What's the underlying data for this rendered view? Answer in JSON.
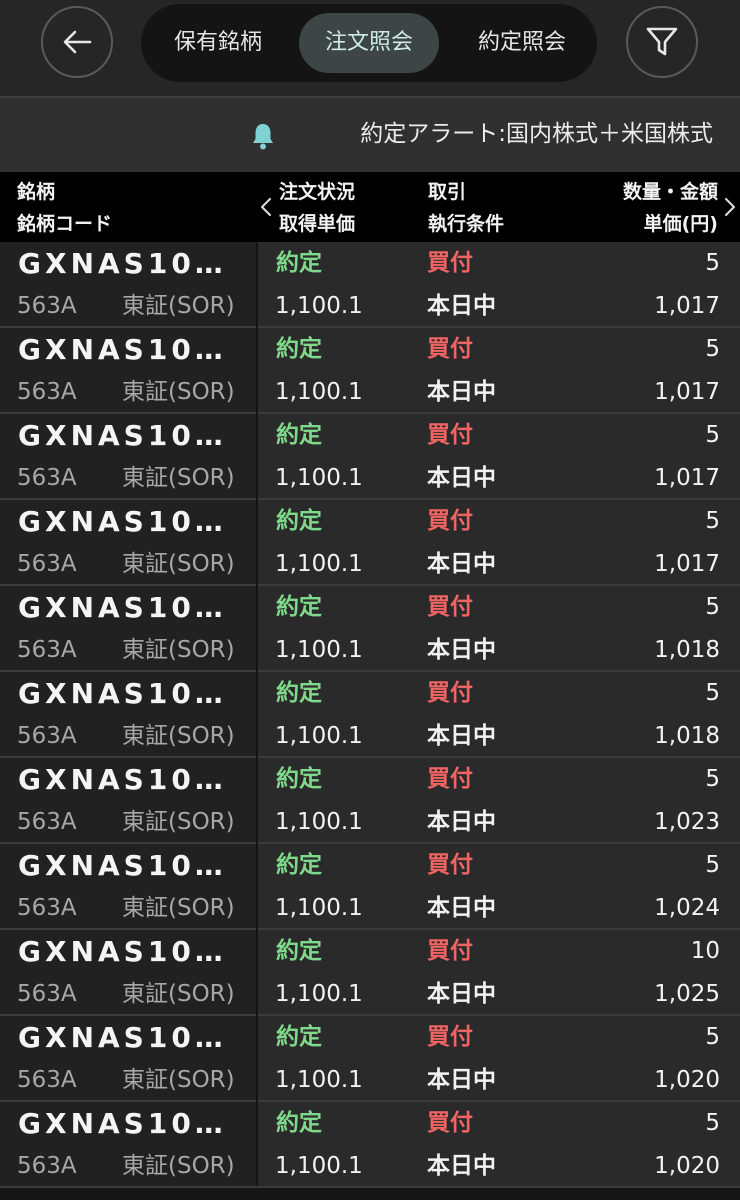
{
  "tabs": [
    {
      "label": "保有銘柄",
      "active": false
    },
    {
      "label": "注文照会",
      "active": true
    },
    {
      "label": "約定照会",
      "active": false
    }
  ],
  "icons": {
    "back": "arrow-left-icon",
    "filter": "funnel-icon",
    "alert": "bell-icon"
  },
  "alert": {
    "text": "約定アラート:国内株式＋米国株式"
  },
  "columns": {
    "col1_top": "銘柄",
    "col1_bottom": "銘柄コード",
    "col2_top": "注文状況",
    "col2_bottom": "取得単価",
    "col3_top": "取引",
    "col3_bottom": "執行条件",
    "col4_top": "数量・金額",
    "col4_bottom": "単価(円)"
  },
  "colors": {
    "status": "#7fd98a",
    "buy": "#f06464",
    "active_tab_bg": "#3d4545",
    "alert_icon": "#7fd3d3"
  },
  "orders": [
    {
      "name": "GXNAS10…",
      "code": "563A",
      "market": "東証(SOR)",
      "status": "約定",
      "price": "1,100.1",
      "side": "買付",
      "condition": "本日中",
      "quantity": "5",
      "unit_price": "1,017"
    },
    {
      "name": "GXNAS10…",
      "code": "563A",
      "market": "東証(SOR)",
      "status": "約定",
      "price": "1,100.1",
      "side": "買付",
      "condition": "本日中",
      "quantity": "5",
      "unit_price": "1,017"
    },
    {
      "name": "GXNAS10…",
      "code": "563A",
      "market": "東証(SOR)",
      "status": "約定",
      "price": "1,100.1",
      "side": "買付",
      "condition": "本日中",
      "quantity": "5",
      "unit_price": "1,017"
    },
    {
      "name": "GXNAS10…",
      "code": "563A",
      "market": "東証(SOR)",
      "status": "約定",
      "price": "1,100.1",
      "side": "買付",
      "condition": "本日中",
      "quantity": "5",
      "unit_price": "1,017"
    },
    {
      "name": "GXNAS10…",
      "code": "563A",
      "market": "東証(SOR)",
      "status": "約定",
      "price": "1,100.1",
      "side": "買付",
      "condition": "本日中",
      "quantity": "5",
      "unit_price": "1,018"
    },
    {
      "name": "GXNAS10…",
      "code": "563A",
      "market": "東証(SOR)",
      "status": "約定",
      "price": "1,100.1",
      "side": "買付",
      "condition": "本日中",
      "quantity": "5",
      "unit_price": "1,018"
    },
    {
      "name": "GXNAS10…",
      "code": "563A",
      "market": "東証(SOR)",
      "status": "約定",
      "price": "1,100.1",
      "side": "買付",
      "condition": "本日中",
      "quantity": "5",
      "unit_price": "1,023"
    },
    {
      "name": "GXNAS10…",
      "code": "563A",
      "market": "東証(SOR)",
      "status": "約定",
      "price": "1,100.1",
      "side": "買付",
      "condition": "本日中",
      "quantity": "5",
      "unit_price": "1,024"
    },
    {
      "name": "GXNAS10…",
      "code": "563A",
      "market": "東証(SOR)",
      "status": "約定",
      "price": "1,100.1",
      "side": "買付",
      "condition": "本日中",
      "quantity": "10",
      "unit_price": "1,025"
    },
    {
      "name": "GXNAS10…",
      "code": "563A",
      "market": "東証(SOR)",
      "status": "約定",
      "price": "1,100.1",
      "side": "買付",
      "condition": "本日中",
      "quantity": "5",
      "unit_price": "1,020"
    },
    {
      "name": "GXNAS10…",
      "code": "563A",
      "market": "東証(SOR)",
      "status": "約定",
      "price": "1,100.1",
      "side": "買付",
      "condition": "本日中",
      "quantity": "5",
      "unit_price": "1,020"
    }
  ]
}
